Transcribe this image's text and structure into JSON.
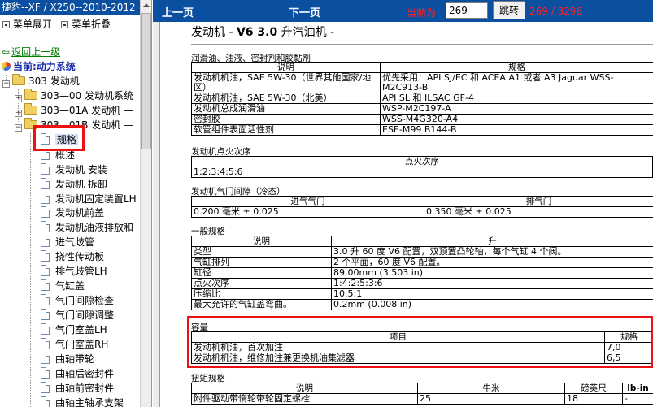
{
  "left_panel": {
    "title": "捷豹--XF / X250--2010-2012",
    "menu_expand": "菜单展开",
    "menu_collapse": "菜单折叠",
    "back_link": "返回上一级",
    "current": "当前:动力系统",
    "tree": [
      {
        "label": "303 发动机",
        "type": "folder",
        "expander": "−"
      },
      {
        "label": "303—00 发动机系统",
        "type": "folder",
        "expander": "+"
      },
      {
        "label": "303—01A 发动机 —",
        "type": "folder",
        "expander": "+"
      },
      {
        "label": "303—01B 发动机 —",
        "type": "folder",
        "expander": "−"
      },
      {
        "label": "规格",
        "type": "doc",
        "selected": true
      },
      {
        "label": "概述",
        "type": "doc"
      },
      {
        "label": "发动机 安装",
        "type": "doc"
      },
      {
        "label": "发动机 拆卸",
        "type": "doc"
      },
      {
        "label": "发动机固定装置LH",
        "type": "doc"
      },
      {
        "label": "发动机前盖",
        "type": "doc"
      },
      {
        "label": "发动机油液排放和",
        "type": "doc"
      },
      {
        "label": "进气歧管",
        "type": "doc"
      },
      {
        "label": "挠性传动板",
        "type": "doc"
      },
      {
        "label": "排气歧管LH",
        "type": "doc"
      },
      {
        "label": "气缸盖",
        "type": "doc"
      },
      {
        "label": "气门间隙检查",
        "type": "doc"
      },
      {
        "label": "气门间隙调整",
        "type": "doc"
      },
      {
        "label": "气门室盖LH",
        "type": "doc"
      },
      {
        "label": "气门室盖RH",
        "type": "doc"
      },
      {
        "label": "曲轴带轮",
        "type": "doc"
      },
      {
        "label": "曲轴后密封件",
        "type": "doc"
      },
      {
        "label": "曲轴前密封件",
        "type": "doc"
      },
      {
        "label": "曲轴主轴承支架",
        "type": "doc"
      }
    ]
  },
  "nav": {
    "prev": "上一页",
    "next": "下一页",
    "current_label": "当前为",
    "page_value": "269",
    "jump": "跳转",
    "page_count": "269 / 3296"
  },
  "document": {
    "title_pre": "发动机 - ",
    "title_bold": "V6 3.0",
    "title_post": " 升汽油机 -",
    "lubricants": {
      "heading": "润滑油、油液、密封剂和胶黏剂",
      "headers": [
        "说明",
        "规格"
      ],
      "rows": [
        [
          "发动机机油，SAE 5W-30（世界其他国家/地区）",
          "优先采用：API SJ/EC 和 ACEA A1 或者 A3 Jaguar WSS-M2C913-B"
        ],
        [
          "发动机机油，SAE 5W-30（北美）",
          "API SL 和 ILSAC GF-4"
        ],
        [
          "发动机总成润滑油",
          "WSP-M2C197-A"
        ],
        [
          "密封胶",
          "WSS-M4G320-A4"
        ],
        [
          "软管组件表面活性剂",
          "ESE-M99 B144-B"
        ]
      ]
    },
    "firing": {
      "heading": "发动机点火次序",
      "header": "点火次序",
      "value": "1:2:3:4:5:6"
    },
    "valve": {
      "heading": "发动机气门间隙（冷态）",
      "headers": [
        "进气气门",
        "排气门"
      ],
      "values": [
        "0.200 毫米 ± 0.025",
        "0.350 毫米 ± 0.025"
      ]
    },
    "general": {
      "heading": "一般规格",
      "headers": [
        "说明",
        "升"
      ],
      "rows": [
        [
          "类型",
          "3.0 升 60 度 V6 配置，双顶置凸轮轴，每个气缸 4 个阀。"
        ],
        [
          "气缸排列",
          "2 个平面，60 度 V6 配置。"
        ],
        [
          "缸径",
          "89.00mm (3.503 in)"
        ],
        [
          "点火次序",
          "1:4:2:5:3:6"
        ],
        [
          "压缩比",
          "10.5:1"
        ],
        [
          "最大允许的气缸盖弯曲。",
          "0.2mm (0.008 in)"
        ]
      ]
    },
    "capacity": {
      "heading": "容量",
      "headers": [
        "项目",
        "规格"
      ],
      "rows": [
        [
          "发动机机油，首次加注",
          "7,0"
        ],
        [
          "发动机机油，维修加注兼更换机油集滤器",
          "6,5"
        ]
      ]
    },
    "torque": {
      "heading": "扭矩规格",
      "headers": [
        "说明",
        "牛米",
        "磅英尺",
        "lb-in"
      ],
      "rows": [
        [
          "附件驱动带惰轮带轮固定螺栓",
          "25",
          "18",
          "-"
        ]
      ]
    }
  }
}
